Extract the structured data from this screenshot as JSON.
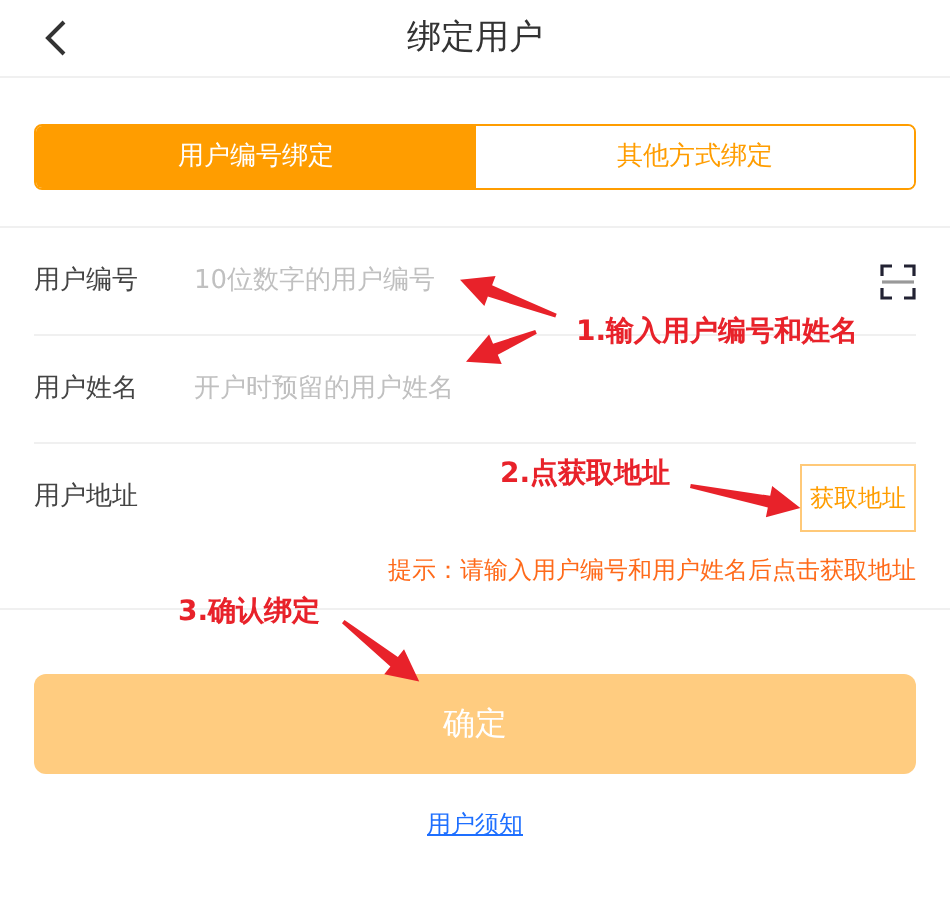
{
  "header": {
    "title": "绑定用户"
  },
  "tabs": [
    {
      "label": "用户编号绑定",
      "selected": true
    },
    {
      "label": "其他方式绑定",
      "selected": false
    }
  ],
  "fields": [
    {
      "kind": "scan-input",
      "label": "用户编号",
      "placeholder": "10位数字的用户编号"
    },
    {
      "kind": "input",
      "label": "用户姓名",
      "placeholder": "开户时预留的用户姓名"
    },
    {
      "kind": "button",
      "label": "用户地址",
      "button": "获取地址"
    }
  ],
  "hint": "提示：请输入用户编号和用户姓名后点击获取地址",
  "submit": {
    "label": "确定",
    "disabled": true
  },
  "notice_link": "用户须知",
  "annotations": [
    {
      "text": "1.输入用户编号和姓名"
    },
    {
      "text": "2.点获取地址"
    },
    {
      "text": "3.确认绑定"
    }
  ]
}
